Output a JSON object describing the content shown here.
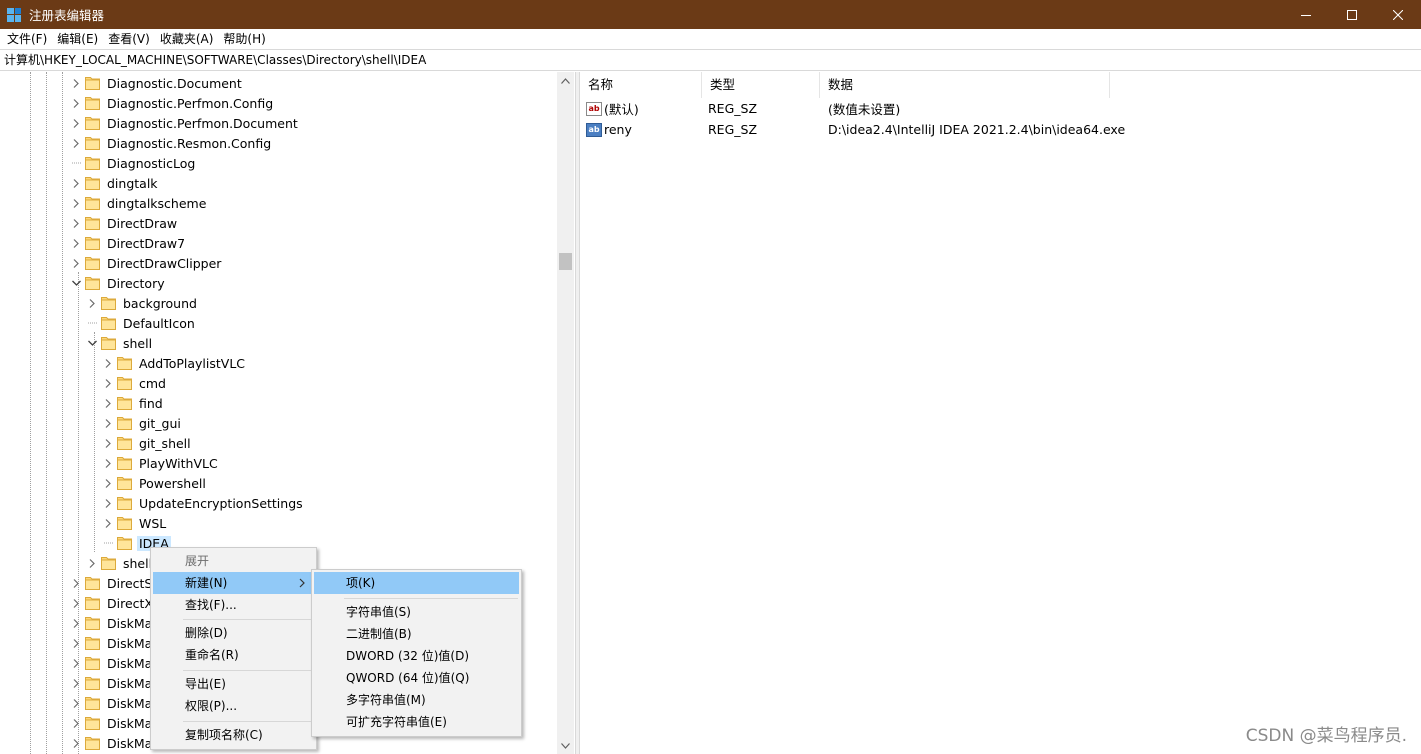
{
  "window": {
    "title": "注册表编辑器",
    "minimize": "minimize",
    "maximize": "maximize",
    "close": "close"
  },
  "menubar": [
    "文件(F)",
    "编辑(E)",
    "查看(V)",
    "收藏夹(A)",
    "帮助(H)"
  ],
  "address": "计算机\\HKEY_LOCAL_MACHINE\\SOFTWARE\\Classes\\Directory\\shell\\IDEA",
  "tree": [
    {
      "label": "Diagnostic.Document",
      "level": 0,
      "expander": "collapsed"
    },
    {
      "label": "Diagnostic.Perfmon.Config",
      "level": 0,
      "expander": "collapsed"
    },
    {
      "label": "Diagnostic.Perfmon.Document",
      "level": 0,
      "expander": "collapsed"
    },
    {
      "label": "Diagnostic.Resmon.Config",
      "level": 0,
      "expander": "collapsed"
    },
    {
      "label": "DiagnosticLog",
      "level": 0,
      "expander": "none"
    },
    {
      "label": "dingtalk",
      "level": 0,
      "expander": "collapsed"
    },
    {
      "label": "dingtalkscheme",
      "level": 0,
      "expander": "collapsed"
    },
    {
      "label": "DirectDraw",
      "level": 0,
      "expander": "collapsed"
    },
    {
      "label": "DirectDraw7",
      "level": 0,
      "expander": "collapsed"
    },
    {
      "label": "DirectDrawClipper",
      "level": 0,
      "expander": "collapsed"
    },
    {
      "label": "Directory",
      "level": 0,
      "expander": "expanded"
    },
    {
      "label": "background",
      "level": 1,
      "expander": "collapsed"
    },
    {
      "label": "DefaultIcon",
      "level": 1,
      "expander": "none"
    },
    {
      "label": "shell",
      "level": 1,
      "expander": "expanded"
    },
    {
      "label": "AddToPlaylistVLC",
      "level": 2,
      "expander": "collapsed"
    },
    {
      "label": "cmd",
      "level": 2,
      "expander": "collapsed"
    },
    {
      "label": "find",
      "level": 2,
      "expander": "collapsed"
    },
    {
      "label": "git_gui",
      "level": 2,
      "expander": "collapsed"
    },
    {
      "label": "git_shell",
      "level": 2,
      "expander": "collapsed"
    },
    {
      "label": "PlayWithVLC",
      "level": 2,
      "expander": "collapsed"
    },
    {
      "label": "Powershell",
      "level": 2,
      "expander": "collapsed"
    },
    {
      "label": "UpdateEncryptionSettings",
      "level": 2,
      "expander": "collapsed"
    },
    {
      "label": "WSL",
      "level": 2,
      "expander": "collapsed"
    },
    {
      "label": "IDEA",
      "level": 2,
      "expander": "none",
      "selected": true
    },
    {
      "label": "shelle",
      "level": 1,
      "expander": "collapsed"
    },
    {
      "label": "DirectSh",
      "level": 0,
      "expander": "collapsed"
    },
    {
      "label": "DirectXF",
      "level": 0,
      "expander": "collapsed"
    },
    {
      "label": "DiskMa",
      "level": 0,
      "expander": "collapsed"
    },
    {
      "label": "DiskMa",
      "level": 0,
      "expander": "collapsed"
    },
    {
      "label": "DiskMa",
      "level": 0,
      "expander": "collapsed"
    },
    {
      "label": "DiskMa",
      "level": 0,
      "expander": "collapsed"
    },
    {
      "label": "DiskMa",
      "level": 0,
      "expander": "collapsed"
    },
    {
      "label": "DiskMa",
      "level": 0,
      "expander": "collapsed"
    },
    {
      "label": "DiskMa",
      "level": 0,
      "expander": "collapsed"
    }
  ],
  "values": {
    "headers": {
      "name": "名称",
      "type": "类型",
      "data": "数据"
    },
    "rows": [
      {
        "icon": "ab",
        "name": "(默认)",
        "type": "REG_SZ",
        "data": "(数值未设置)"
      },
      {
        "icon": "ab",
        "name": "reny",
        "type": "REG_SZ",
        "data": "D:\\idea2.4\\IntelliJ IDEA 2021.2.4\\bin\\idea64.exe"
      }
    ]
  },
  "context_menu": {
    "items": [
      {
        "label": "展开",
        "disabled": true
      },
      {
        "label": "新建(N)",
        "hover": true,
        "submenu": true
      },
      {
        "label": "查找(F)..."
      },
      {
        "label": "删除(D)"
      },
      {
        "label": "重命名(R)"
      },
      {
        "label": "导出(E)"
      },
      {
        "label": "权限(P)..."
      },
      {
        "label": "复制项名称(C)"
      }
    ]
  },
  "submenu": {
    "items": [
      {
        "label": "项(K)",
        "hover": true
      },
      {
        "label": "字符串值(S)"
      },
      {
        "label": "二进制值(B)"
      },
      {
        "label": "DWORD (32 位)值(D)"
      },
      {
        "label": "QWORD (64 位)值(Q)"
      },
      {
        "label": "多字符串值(M)"
      },
      {
        "label": "可扩充字符串值(E)"
      }
    ]
  },
  "watermark": "CSDN @菜鸟程序员."
}
